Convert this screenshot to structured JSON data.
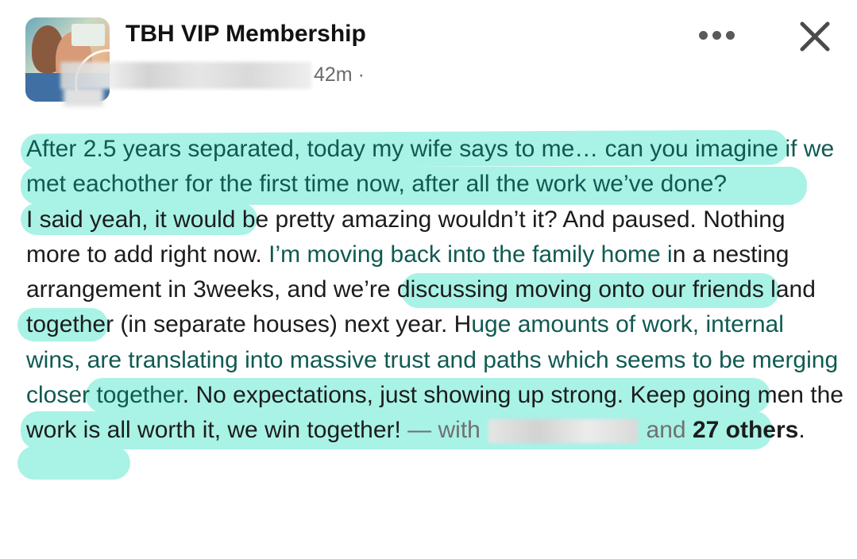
{
  "post": {
    "group_name": "TBH VIP Membership",
    "timestamp": "42m",
    "separator": "·",
    "body": {
      "p1": "After 2.5 years separated, today my wife says to me… can you imagine if we met eachother for the first time now, after all the work we’ve done?",
      "p2_a": "I said yeah, it would be pretty amazing wouldn’t it? And paused. Nothing more to add right now. ",
      "p2_hl1": "I’m moving back into the family home i",
      "p2_b": "n a nesting arrangement in 3weeks, and we’re discussing moving onto our friends land together (in separate houses) next year. H",
      "p2_hl2": "uge amounts of work, internal wins, are translating into massive trust and paths which seems to be merging closer together",
      "p2_c": ". No expectations, just showing up strong. Keep going men the work is all worth it, we win together!",
      "with_label": " — with ",
      "and_label": " and ",
      "others_count": "27",
      "others_label": "others",
      "period": "."
    }
  },
  "icons": {
    "more": "more-horizontal-icon",
    "close": "close-icon"
  },
  "colors": {
    "highlight": "#a9f2e6",
    "text": "#1c1c1c",
    "muted": "#6b6b6b"
  }
}
